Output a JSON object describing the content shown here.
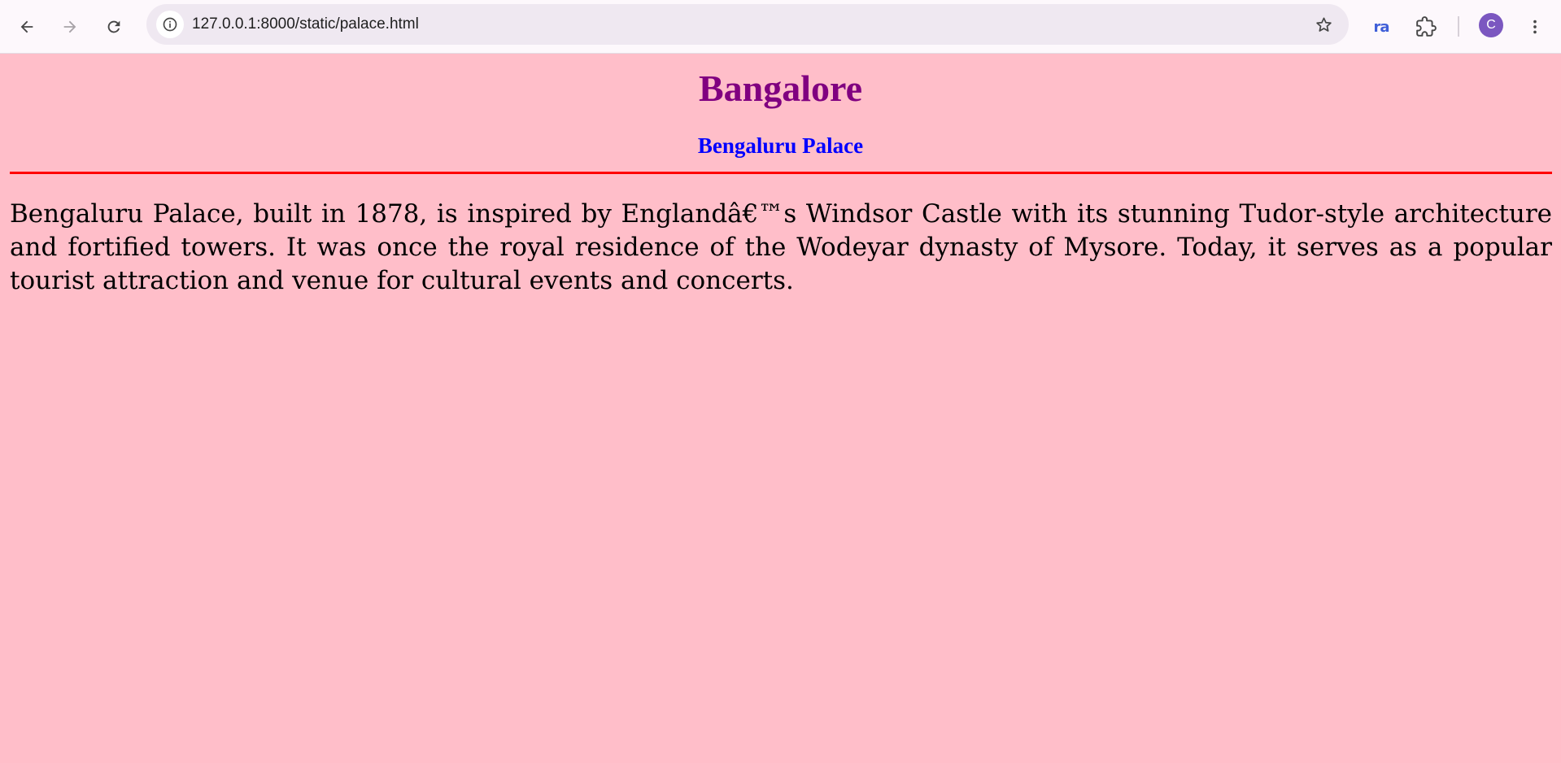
{
  "browser": {
    "url": "127.0.0.1:8000/static/palace.html",
    "extension_label": "ra",
    "profile_initial": "C",
    "icons": {
      "back": "arrow-left-icon",
      "forward": "arrow-right-icon",
      "reload": "reload-icon",
      "site_info": "info-icon",
      "bookmark": "star-icon",
      "extensions": "puzzle-icon",
      "menu": "kebab-menu-icon"
    }
  },
  "page": {
    "background_color": "#ffbec9",
    "title": "Bangalore",
    "title_color": "#800080",
    "subtitle": "Bengaluru Palace",
    "subtitle_color": "#0000ff",
    "rule_color": "#ff0000",
    "paragraph": "Bengaluru Palace, built in 1878, is inspired by Englandâ€™s Windsor Castle with its stunning Tudor-style architecture and fortified towers. It was once the royal residence of the Wodeyar dynasty of Mysore. Today, it serves as a popular tourist attraction and venue for cultural events and concerts."
  }
}
